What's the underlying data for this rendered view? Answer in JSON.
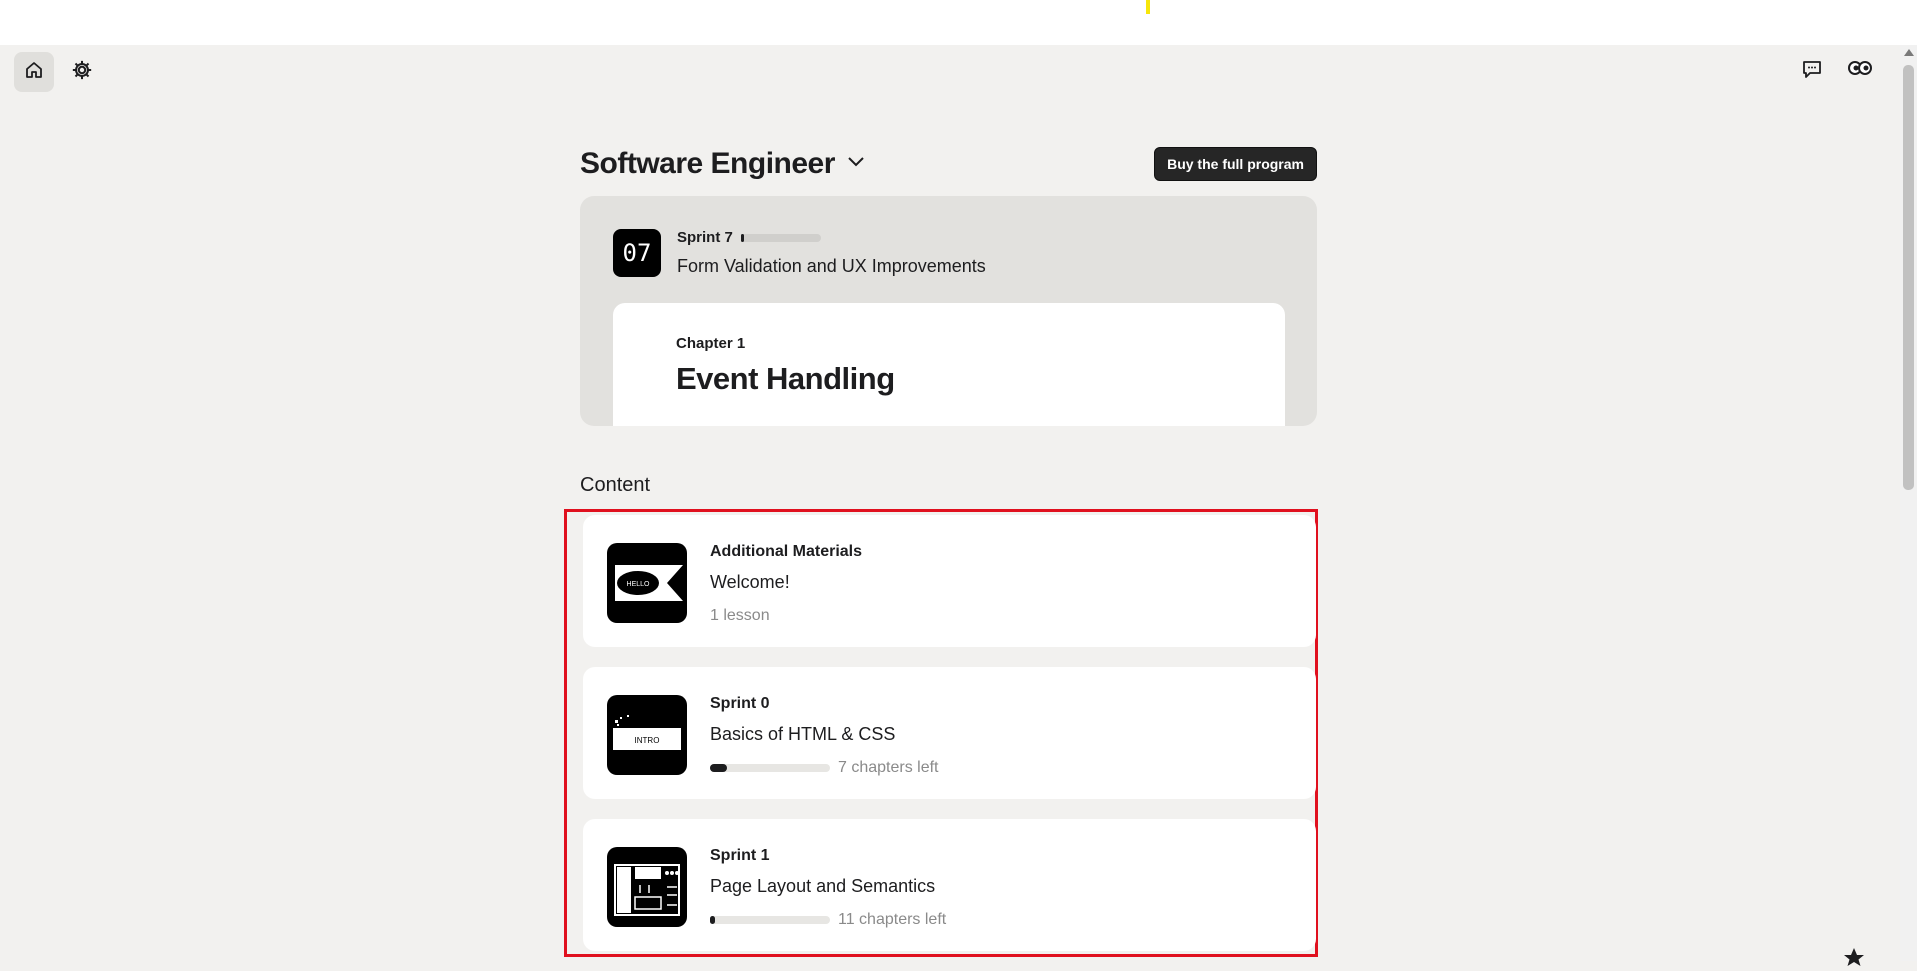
{
  "nav": {
    "home_icon": "home-icon",
    "settings_icon": "gear-icon",
    "chat_icon": "chat-icon",
    "avatar_icon": "mascot-avatar-icon"
  },
  "program": {
    "title": "Software Engineer",
    "buy_label": "Buy the full program"
  },
  "current_sprint": {
    "badge": "07",
    "label": "Sprint 7",
    "progress": 0.04,
    "name": "Form Validation and UX Improvements",
    "chapter_label": "Chapter 1",
    "chapter_title": "Event Handling"
  },
  "content": {
    "label": "Content",
    "items": [
      {
        "kicker": "Additional Materials",
        "title": "Welcome!",
        "meta": "1 lesson",
        "progress": null,
        "thumb_text": "HELLO"
      },
      {
        "kicker": "Sprint 0",
        "title": "Basics of HTML & CSS",
        "meta": "7 chapters left",
        "progress": 0.14,
        "thumb_text": "INTRO"
      },
      {
        "kicker": "Sprint 1",
        "title": "Page Layout and Semantics",
        "meta": "11 chapters left",
        "progress": 0.03,
        "thumb_text": ""
      }
    ]
  },
  "colors": {
    "background": "#f2f1ef",
    "card": "#ffffff",
    "sprint_card": "#e2e1de",
    "accent_dark": "#1d1d1f",
    "highlight": "#e0101e"
  }
}
